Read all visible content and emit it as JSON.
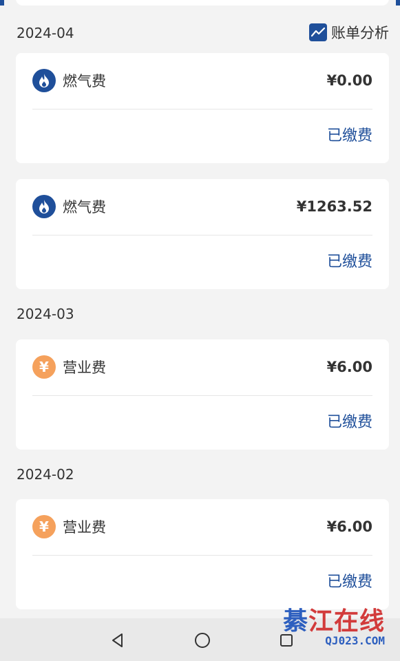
{
  "header": {
    "analysis_label": "账单分析"
  },
  "groups": [
    {
      "month": "2024-04",
      "bills": [
        {
          "name": "燃气费",
          "amount": "¥0.00",
          "status": "已缴费",
          "icon": "flame-icon"
        },
        {
          "name": "燃气费",
          "amount": "¥1263.52",
          "status": "已缴费",
          "icon": "flame-icon"
        }
      ]
    },
    {
      "month": "2024-03",
      "bills": [
        {
          "name": "营业费",
          "amount": "¥6.00",
          "status": "已缴费",
          "icon": "yuan-icon",
          "icon_glyph": "¥"
        }
      ]
    },
    {
      "month": "2024-02",
      "bills": [
        {
          "name": "营业费",
          "amount": "¥6.00",
          "status": "已缴费",
          "icon": "yuan-icon",
          "icon_glyph": "¥"
        }
      ]
    }
  ],
  "watermark": {
    "text_cn": "綦江在线",
    "text_en": "QJ023.COM"
  },
  "colors": {
    "accent": "#1f4f9a",
    "fee_icon": "#f5a15c",
    "background": "#f3f3f3"
  }
}
